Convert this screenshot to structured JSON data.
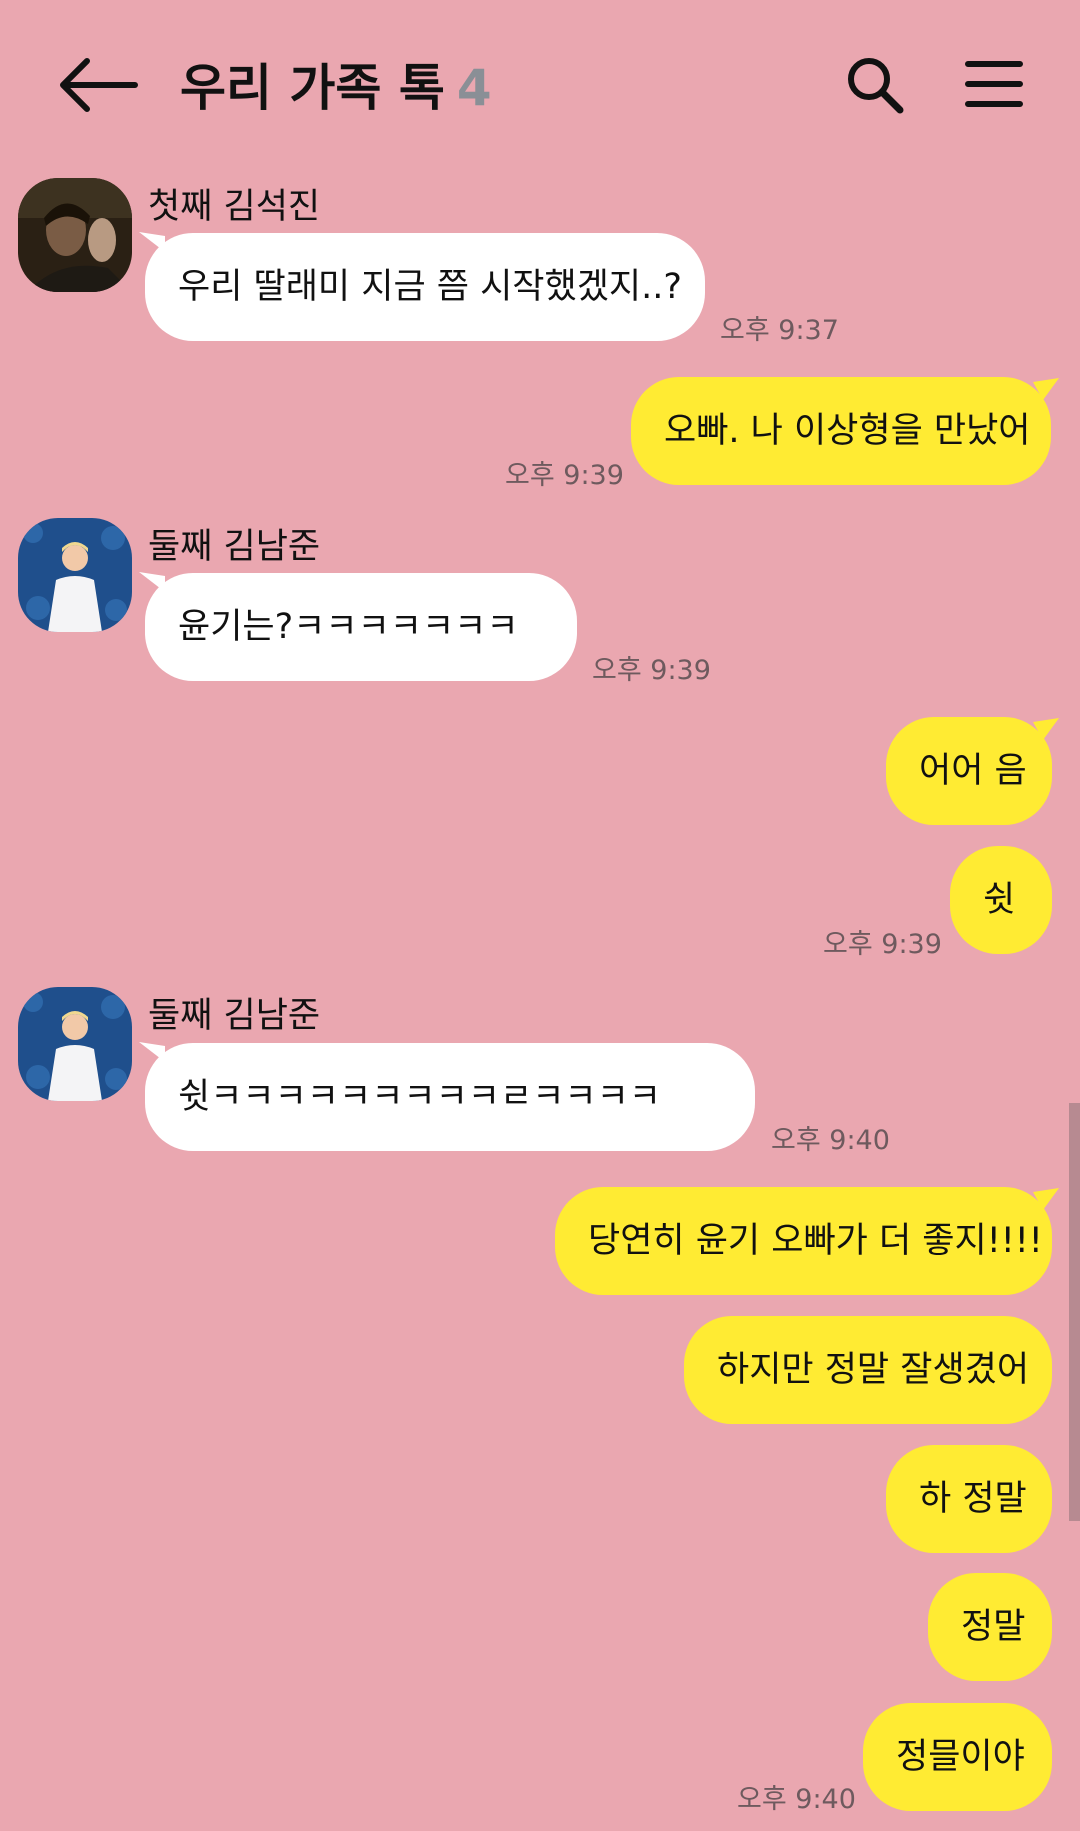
{
  "header": {
    "title": "우리 가족 톡",
    "member_count": "4",
    "back_icon": "arrow-left-icon",
    "search_icon": "search-icon",
    "menu_icon": "hamburger-menu-icon"
  },
  "colors": {
    "background": "#eaa7b0",
    "incoming_bubble": "#ffffff",
    "outgoing_bubble": "#ffeb33",
    "timestamp": "#6e5a5e",
    "member_count": "#8a8f96"
  },
  "messages": [
    {
      "sender": "첫째 김석진",
      "text": "우리 딸래미 지금 쯤 시작했겠지..?",
      "time": "오후 9:37"
    },
    {
      "text": "오빠. 나 이상형을 만났어",
      "time": "오후 9:39"
    },
    {
      "sender": "둘째 김남준",
      "text": "윤기는?ㅋㅋㅋㅋㅋㅋㅋ",
      "time": "오후 9:39"
    },
    {
      "text": "어어 음"
    },
    {
      "text": "쉿",
      "time": "오후 9:39"
    },
    {
      "sender": "둘째 김남준",
      "text": "쉿ㅋㅋㅋㅋㅋㅋㅋㅋㅋㄹㅋㅋㅋㅋ",
      "time": "오후 9:40"
    },
    {
      "text": "당연히 윤기 오빠가 더 좋지!!!!"
    },
    {
      "text": "하지만 정말 잘생겼어"
    },
    {
      "text": "하 정말"
    },
    {
      "text": "정말"
    },
    {
      "text": "정믈이야",
      "time": "오후 9:40"
    }
  ]
}
